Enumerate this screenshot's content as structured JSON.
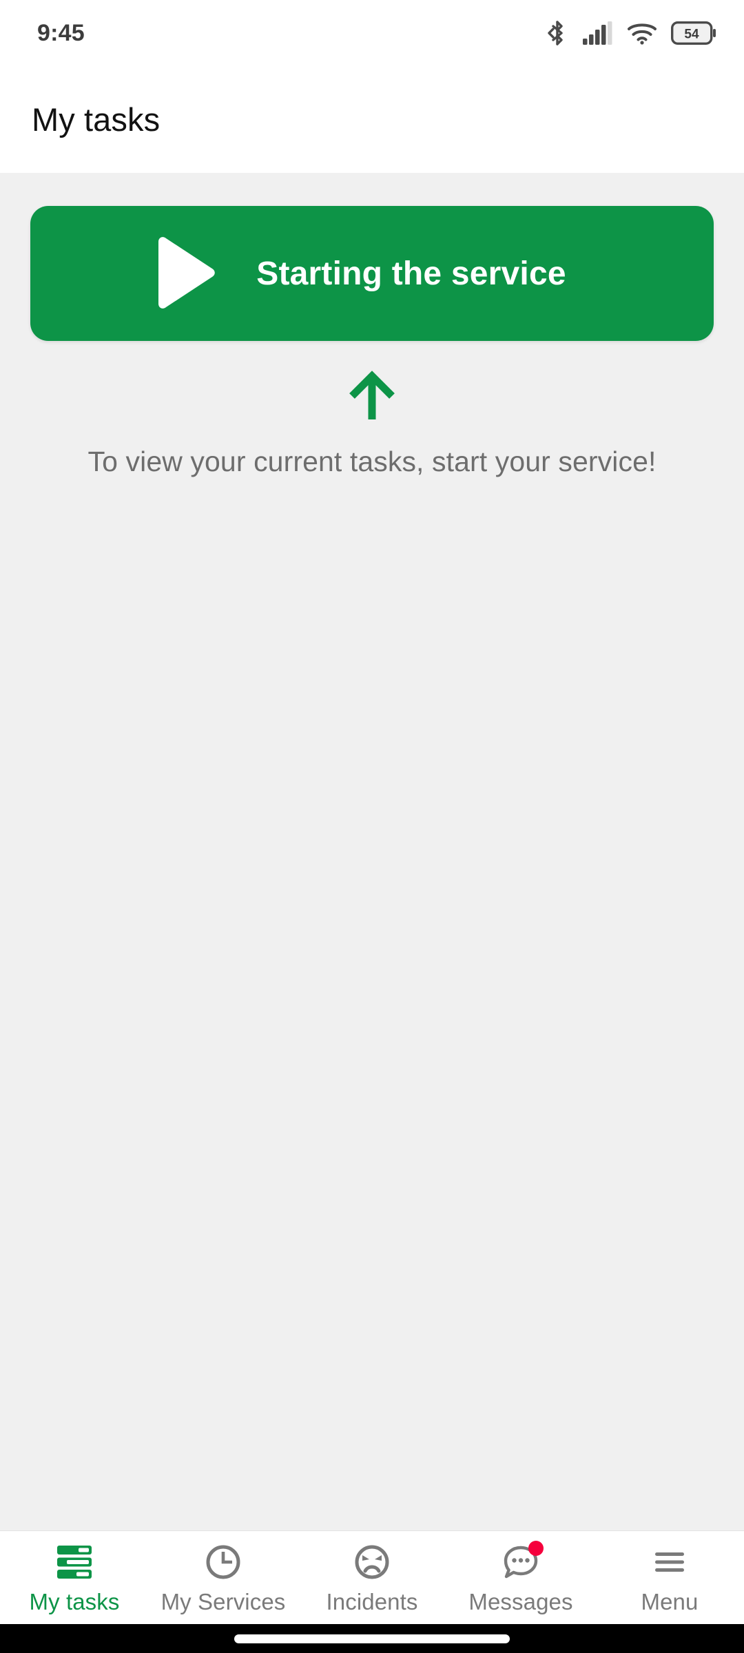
{
  "status_bar": {
    "time": "9:45",
    "battery_level": "54",
    "icons": [
      "bluetooth-icon",
      "cellular-signal-icon",
      "wifi-icon",
      "battery-icon"
    ],
    "signal_bars_filled": 4,
    "signal_bars_total": 5
  },
  "header": {
    "title": "My tasks"
  },
  "main": {
    "start_button": {
      "label": "Starting the service",
      "icon": "play-icon",
      "color": "#0d9447",
      "text_color": "#ffffff"
    },
    "arrow": {
      "icon": "arrow-up-icon",
      "color": "#0d9447"
    },
    "hint": "To view your current tasks, start your service!",
    "hint_color": "#6d6d6d",
    "background_color": "#f0f0f0"
  },
  "bottom_nav": {
    "active_color": "#0d9447",
    "inactive_color": "#7a7a7a",
    "badge_color": "#f5003c",
    "items": [
      {
        "label": "My tasks",
        "icon": "task-list-icon",
        "active": true,
        "badge": false
      },
      {
        "label": "My Services",
        "icon": "clock-icon",
        "active": false,
        "badge": false
      },
      {
        "label": "Incidents",
        "icon": "angry-face-icon",
        "active": false,
        "badge": false
      },
      {
        "label": "Messages",
        "icon": "chat-bubble-icon",
        "active": false,
        "badge": true
      },
      {
        "label": "Menu",
        "icon": "hamburger-icon",
        "active": false,
        "badge": false
      }
    ]
  }
}
